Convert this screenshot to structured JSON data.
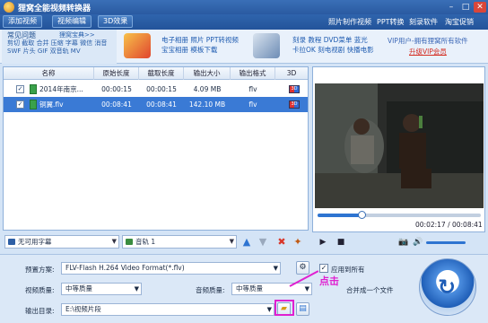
{
  "window": {
    "title": "狸窝全能视频转换器",
    "min_label": "–",
    "max_label": "□",
    "close_label": "✕"
  },
  "tabs": {
    "add_video": "添加视频",
    "edit_video": "视频编辑",
    "effect_3d": "3D效果"
  },
  "top_links": [
    "照片制作视频",
    "PPT转换",
    "刻录软件",
    "淘宝促销"
  ],
  "promo": {
    "faq_heading": "常见问题",
    "faq_bao": "狸窝宝典>>",
    "faq_links": "剪切 截取 合并 压缩 字幕 微信 消音 SWF 片头 GIF 双音轨 MV",
    "promo1_line1": "电子相册 照片 PPT转视频",
    "promo1_line2": "宝宝相册 模板下载",
    "promo2_line1": "刻录 教程 DVD菜单 蓝光",
    "promo2_line2": "卡拉OK 刻电视剧 快播电影",
    "vip_line": "VIP用户-拥有狸窝所有软件",
    "vip_link": "升级VIP会员"
  },
  "table": {
    "columns": [
      "名称",
      "原始长度",
      "截取长度",
      "输出大小",
      "输出格式",
      "3D"
    ],
    "rows": [
      {
        "name": "2014年南京...",
        "original": "00:00:15",
        "clip": "00:00:15",
        "size": "4.09 MB",
        "format": "flv",
        "checked": true,
        "selected": false
      },
      {
        "name": "铜翼.flv",
        "original": "00:08:41",
        "clip": "00:08:41",
        "size": "142.10 MB",
        "format": "flv",
        "checked": true,
        "selected": true
      }
    ]
  },
  "list_toolbar": {
    "subtitle_select": "无可用字幕",
    "audio_select": "音轨 1"
  },
  "player": {
    "progress": 0.27,
    "time": "00:02:17 / 00:08:41",
    "volume": 0.85
  },
  "settings": {
    "preset_label": "预置方案:",
    "preset_value": "FLV-Flash H.264 Video Format(*.flv)",
    "apply_all_label": "应用到所有",
    "apply_all_checked": true,
    "video_quality_label": "视频质量:",
    "video_quality_value": "中等质量",
    "audio_quality_label": "音频质量:",
    "audio_quality_value": "中等质量",
    "merge_label": "合并成一个文件",
    "output_dir_label": "输出目录:",
    "output_dir_value": "E:\\视频片段"
  },
  "annotation": {
    "text": "点击",
    "color": "#e020d0"
  }
}
